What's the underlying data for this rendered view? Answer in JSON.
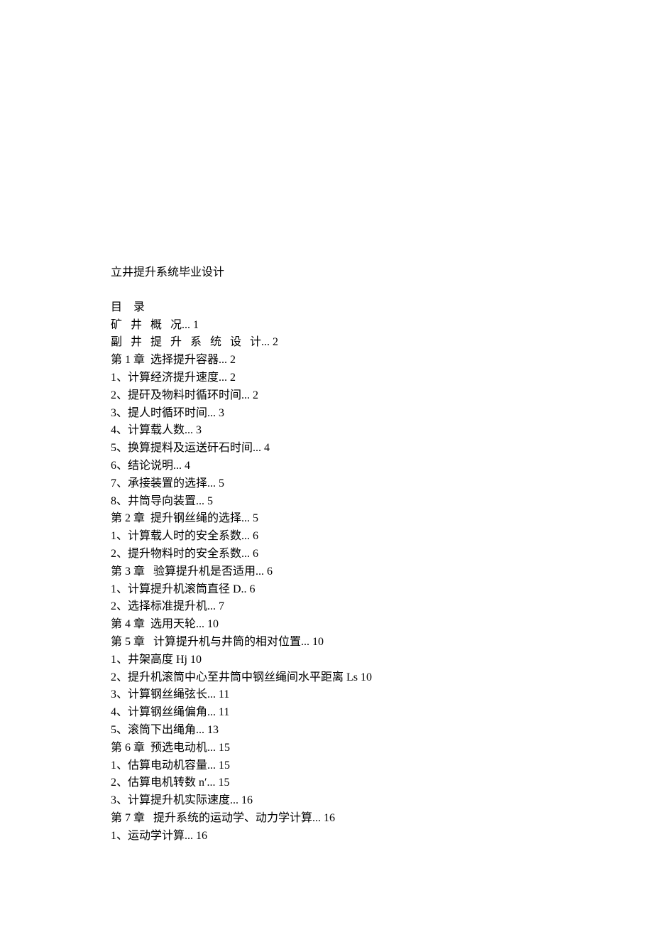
{
  "title": "立井提升系统毕业设计",
  "toc": [
    "目    录",
    "矿   井   概   况... 1",
    "副   井   提   升   系   统   设   计... 2",
    "第 1 章  选择提升容器... 2",
    "1、计算经济提升速度... 2",
    "2、提矸及物料时循环时间... 2",
    "3、提人时循环时间... 3",
    "4、计算载人数... 3",
    "5、换算提料及运送矸石时间... 4",
    "6、结论说明... 4",
    "7、承接装置的选择... 5",
    "8、井筒导向装置... 5",
    "第 2 章  提升钢丝绳的选择... 5",
    "1、计算载人时的安全系数... 6",
    "2、提升物料时的安全系数... 6",
    "第 3 章   验算提升机是否适用... 6",
    "1、计算提升机滚筒直径 D.. 6",
    "2、选择标准提升机... 7",
    "第 4 章  选用天轮... 10",
    "第 5 章   计算提升机与井筒的相对位置... 10",
    "1、井架高度 Hj 10",
    "2、提升机滚筒中心至井筒中钢丝绳间水平距离 Ls 10",
    "3、计算钢丝绳弦长... 11",
    "4、计算钢丝绳偏角... 11",
    "5、滚筒下出绳角... 13",
    "第 6 章  预选电动机... 15",
    "1、估算电动机容量... 15",
    "2、估算电机转数 n′... 15",
    "3、计算提升机实际速度... 16",
    "第 7 章   提升系统的运动学、动力学计算... 16",
    "1、运动学计算... 16"
  ]
}
